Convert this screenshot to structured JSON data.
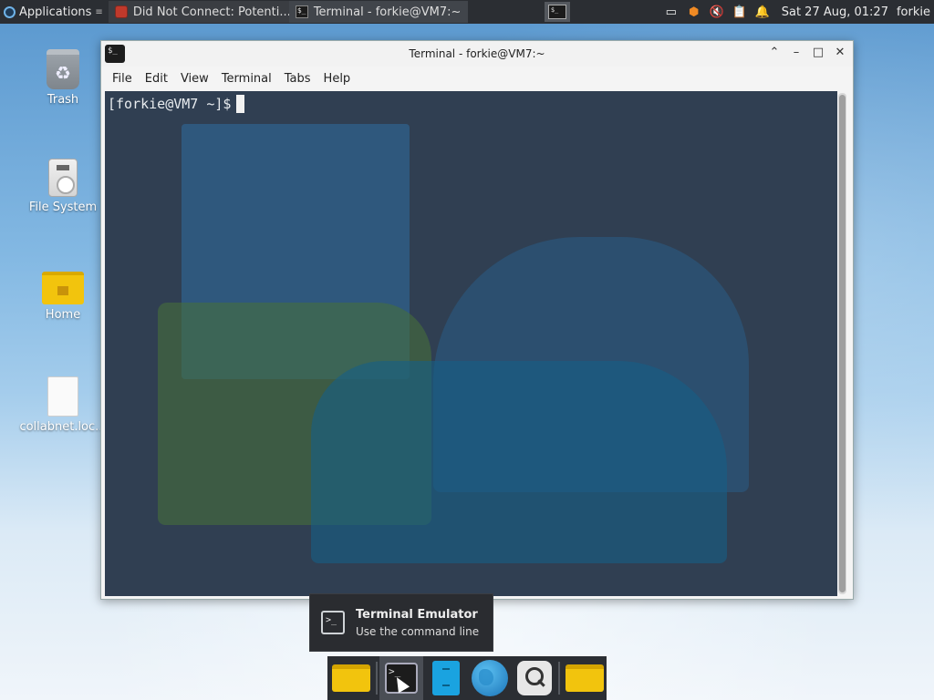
{
  "top_panel": {
    "applications_label": "Applications",
    "tasks": [
      {
        "title": "Did Not Connect: Potenti..."
      },
      {
        "title": "Terminal - forkie@VM7:~"
      }
    ],
    "clock": "Sat 27 Aug, 01:27",
    "user": "forkie",
    "tray_icons": [
      "display-icon",
      "package-update-icon",
      "volume-muted-icon",
      "clipboard-icon",
      "notification-bell-icon"
    ]
  },
  "desktop_icons": [
    {
      "label": "Trash",
      "icon": "trash-icon"
    },
    {
      "label": "File System",
      "icon": "drive-icon"
    },
    {
      "label": "Home",
      "icon": "home-folder-icon"
    },
    {
      "label": "collabnet.loc...",
      "icon": "file-icon"
    }
  ],
  "terminal_window": {
    "title": "Terminal - forkie@VM7:~",
    "menu": [
      "File",
      "Edit",
      "View",
      "Terminal",
      "Tabs",
      "Help"
    ],
    "prompt": "[forkie@VM7 ~]$"
  },
  "tooltip": {
    "title": "Terminal Emulator",
    "subtitle": "Use the command line"
  },
  "dock": {
    "items": [
      "folder-icon",
      "terminal-icon",
      "file-manager-icon",
      "web-browser-icon",
      "search-icon",
      "folder-icon"
    ]
  },
  "colors": {
    "panel": "#2b2e33",
    "terminal_bg": "#303f52",
    "desktop_sky": "#84b9e3"
  }
}
